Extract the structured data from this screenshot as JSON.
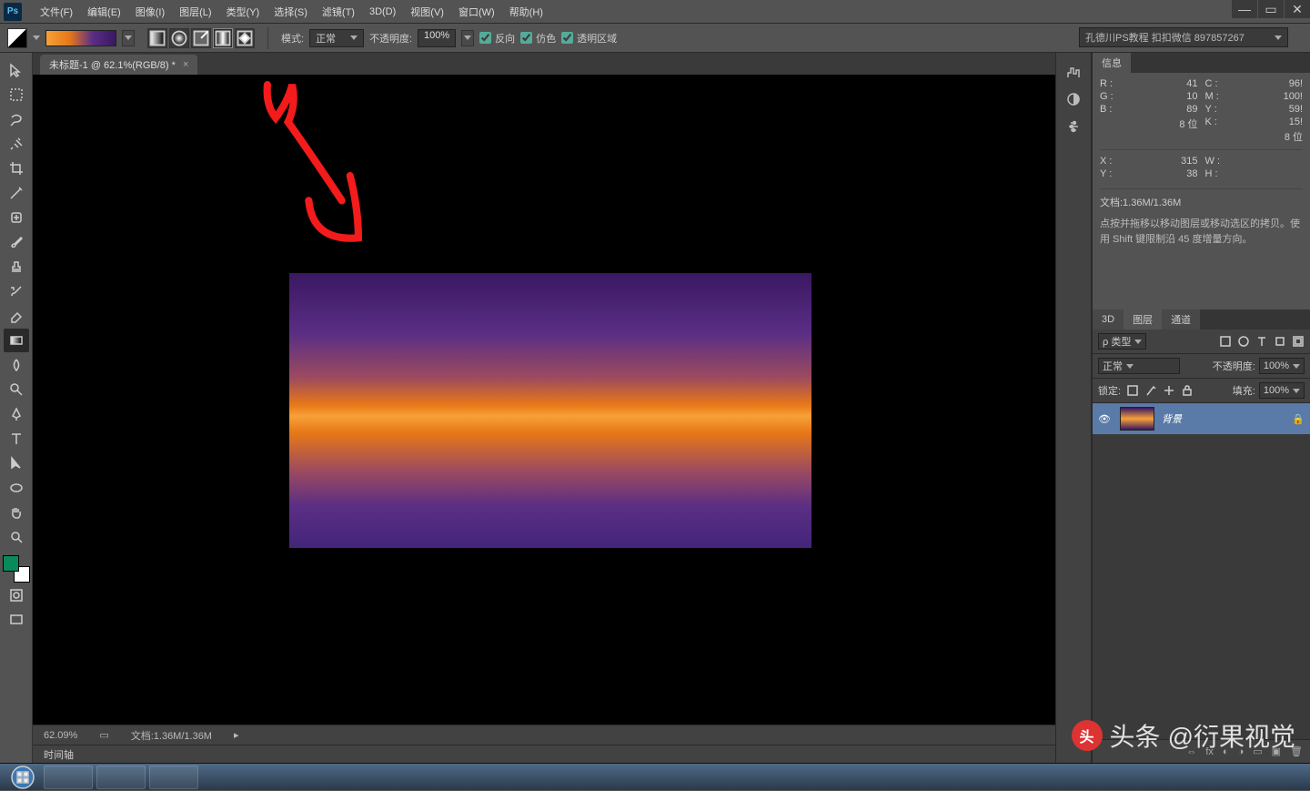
{
  "menu": {
    "file": "文件(F)",
    "edit": "编辑(E)",
    "image": "图像(I)",
    "layer": "图层(L)",
    "type": "类型(Y)",
    "select": "选择(S)",
    "filter": "滤镜(T)",
    "threeD": "3D(D)",
    "view": "视图(V)",
    "window": "窗口(W)",
    "help": "帮助(H)"
  },
  "options": {
    "mode_label": "模式:",
    "mode_value": "正常",
    "opacity_label": "不透明度:",
    "opacity_value": "100%",
    "reverse": "反向",
    "dither": "仿色",
    "transparent": "透明区域"
  },
  "watermark_box": "孔德川PS教程 扣扣微信 897857267",
  "doc": {
    "tab": "未标题-1 @ 62.1%(RGB/8) *"
  },
  "status": {
    "zoom": "62.09%",
    "docinfo": "文档:1.36M/1.36M"
  },
  "timeline_label": "时间轴",
  "info": {
    "tab": "信息",
    "r_label": "R :",
    "r": "41",
    "g_label": "G :",
    "g": "10",
    "b_label": "B :",
    "b": "89",
    "c_label": "C :",
    "c": "96!",
    "m_label": "M :",
    "m": "100!",
    "y_label": "Y :",
    "y": "59!",
    "k_label": "K :",
    "k": "15!",
    "bit1": "8 位",
    "bit2": "8 位",
    "x_label": "X :",
    "x": "315",
    "yy_label": "Y :",
    "yy": "38",
    "w_label": "W :",
    "h_label": "H :",
    "docline": "文档:1.36M/1.36M",
    "hint": "点按并拖移以移动图层或移动选区的拷贝。使用 Shift 键限制沿 45 度增量方向。"
  },
  "layers": {
    "tab_3d": "3D",
    "tab_layers": "图层",
    "tab_channels": "通道",
    "filter": "ρ 类型",
    "blend": "正常",
    "opacity_label": "不透明度:",
    "opacity": "100%",
    "lock_label": "锁定:",
    "fill_label": "填充:",
    "fill": "100%",
    "bg_name": "背景"
  },
  "overlay": {
    "brand": "头条",
    "at": "@衍果视觉"
  }
}
